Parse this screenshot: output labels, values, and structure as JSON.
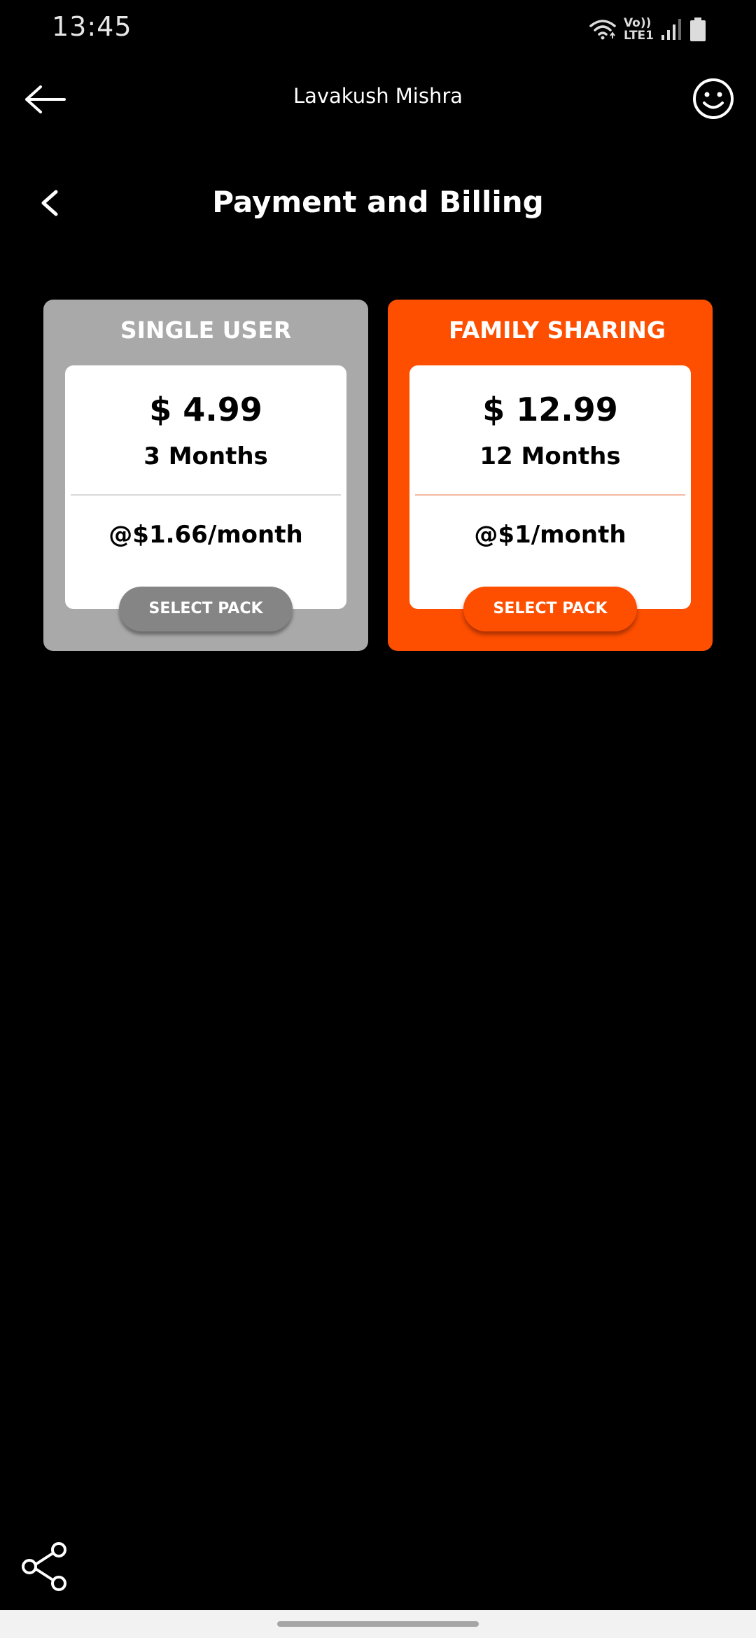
{
  "status_bar": {
    "time": "13:45",
    "network_line1": "Vo))",
    "network_line2": "LTE1",
    "icons": [
      "wifi-icon",
      "signal-icon",
      "battery-icon"
    ]
  },
  "app_bar": {
    "title": "Lavakush Mishra",
    "back_icon": "arrow-left-icon",
    "profile_icon": "smiley-icon"
  },
  "page": {
    "title": "Payment and Billing",
    "back_icon": "chevron-left-icon"
  },
  "plans": [
    {
      "name": "SINGLE USER",
      "price": "$ 4.99",
      "duration": "3 Months",
      "rate": "@$1.66/month",
      "button_label": "SELECT PACK",
      "color": "#a9a9a9"
    },
    {
      "name": "FAMILY SHARING",
      "price": "$ 12.99",
      "duration": "12 Months",
      "rate": "@$1/month",
      "button_label": "SELECT PACK",
      "color": "#fe4f00"
    }
  ],
  "share": {
    "icon": "share-icon"
  }
}
